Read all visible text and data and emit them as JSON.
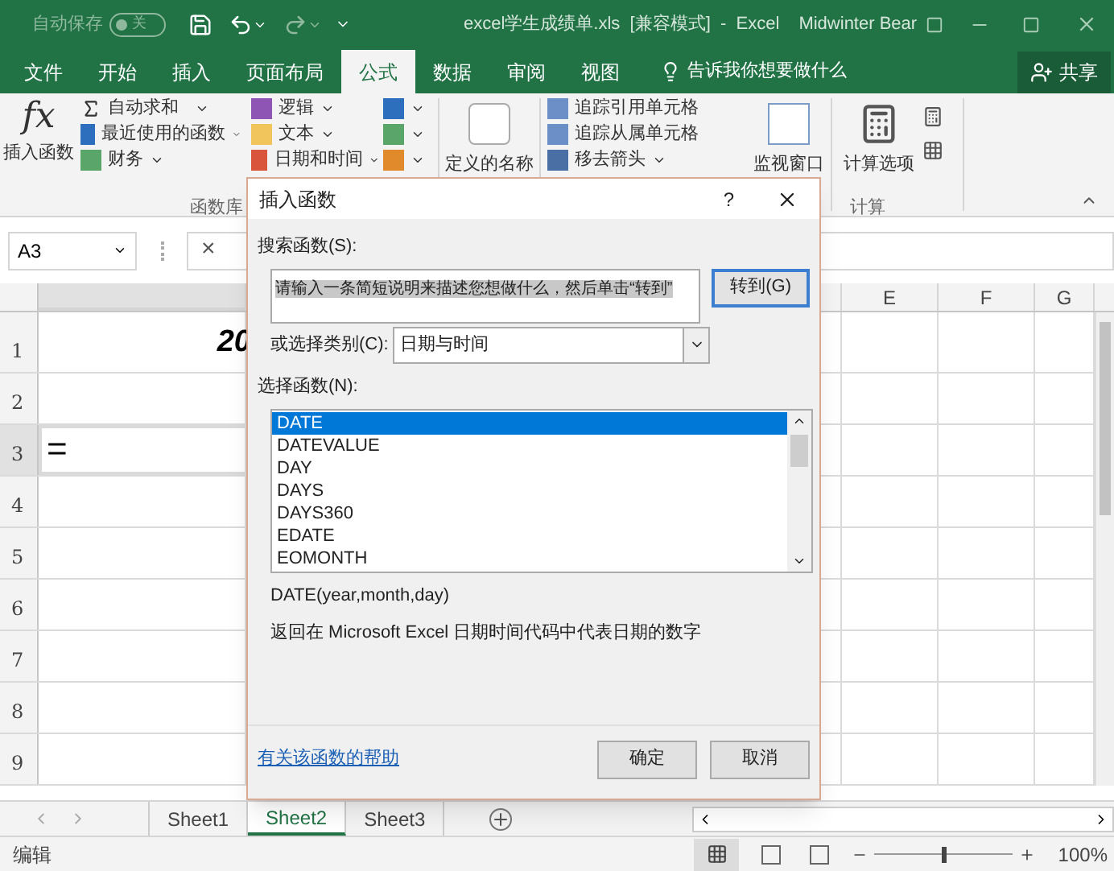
{
  "title_bar": {
    "autosave_label": "自动保存",
    "autosave_state": "关",
    "autosave_on": false,
    "document_title": "excel学生成绩单.xls  [兼容模式]  -  Excel",
    "user": "Midwinter Bear"
  },
  "ribbon_tabs": [
    {
      "label": "文件",
      "selected": false
    },
    {
      "label": "开始",
      "selected": false
    },
    {
      "label": "插入",
      "selected": false
    },
    {
      "label": "页面布局",
      "selected": false
    },
    {
      "label": "公式",
      "selected": true
    },
    {
      "label": "数据",
      "selected": false
    },
    {
      "label": "审阅",
      "selected": false
    },
    {
      "label": "视图",
      "selected": false
    }
  ],
  "tell_me": "告诉我你想要做什么",
  "share": "共享",
  "ribbon": {
    "insert_function_icon_text": "fx",
    "insert_function": "插入函数",
    "autosum": "自动求和",
    "recent": "最近使用的函数",
    "financial": "财务",
    "logical": "逻辑",
    "text": "文本",
    "datetime": "日期和时间",
    "function_library": "函数库",
    "defined_names": "定义的名称",
    "trace_precedents": "追踪引用单元格",
    "trace_dependents": "追踪从属单元格",
    "remove_arrows": "移去箭头",
    "watch_window": "监视窗口",
    "calc_options": "计算选项",
    "calculation": "计算"
  },
  "formula_bar": {
    "name_box": "A3",
    "cancel": "×"
  },
  "sheet": {
    "columns": [
      "E",
      "F",
      "G"
    ],
    "rows": [
      "1",
      "2",
      "3",
      "4",
      "5",
      "6",
      "7",
      "8",
      "9"
    ],
    "cell_a1": "20",
    "cell_a3": "="
  },
  "sheet_tabs": [
    {
      "label": "Sheet1",
      "selected": false
    },
    {
      "label": "Sheet2",
      "selected": true
    },
    {
      "label": "Sheet3",
      "selected": false
    }
  ],
  "status_bar": {
    "mode": "编辑",
    "zoom": "100%",
    "level": 0.5
  },
  "dialog": {
    "title": "插入函数",
    "help": "?",
    "search_label": "搜索函数(S):",
    "search_value": "请输入一条简短说明来描述您想做什么，然后单击“转到”",
    "go_button": "转到(G)",
    "category_label": "或选择类别(C):",
    "category_value": "日期与时间",
    "function_label": "选择函数(N):",
    "functions": [
      {
        "name": "DATE",
        "selected": true
      },
      {
        "name": "DATEVALUE",
        "selected": false
      },
      {
        "name": "DAY",
        "selected": false
      },
      {
        "name": "DAYS",
        "selected": false
      },
      {
        "name": "DAYS360",
        "selected": false
      },
      {
        "name": "EDATE",
        "selected": false
      },
      {
        "name": "EOMONTH",
        "selected": false
      }
    ],
    "signature": "DATE(year,month,day)",
    "description": "返回在 Microsoft Excel 日期时间代码中代表日期的数字",
    "help_link": "有关该函数的帮助",
    "ok": "确定",
    "cancel": "取消"
  }
}
